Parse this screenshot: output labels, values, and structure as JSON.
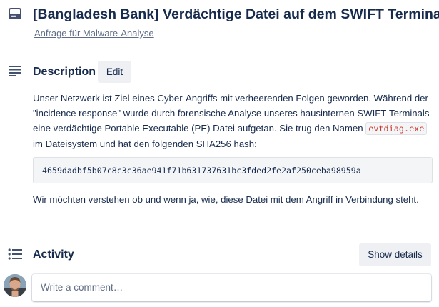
{
  "card": {
    "title": "[Bangladesh Bank] Verdächtige Datei auf dem SWIFT Terminal",
    "list_link": "Anfrage für Malware-Analyse",
    "icon": "card-icon"
  },
  "description": {
    "icon": "description-lines-icon",
    "heading": "Description",
    "edit_label": "Edit",
    "para1_part1": "Unser Netzwerk ist Ziel eines Cyber-Angriffs mit verheerenden Folgen geworden. Während der \"incidence response\" wurde durch forensische Analyse unseres hausinternen SWIFT-Terminals eine verdächtige Portable Executable (PE) Datei aufgetan. Sie trug den Namen",
    "file_name": "evtdiag.exe",
    "para1_part2": "im Dateisystem und hat den folgenden SHA256 hash:",
    "hash": "4659dadbf5b07c8c3c36ae941f71b631737631bc3fded2fe2af250ceba98959a",
    "para2": "Wir möchten verstehen ob und wenn ja, wie, diese Datei mit dem Angriff in Verbindung steht."
  },
  "activity": {
    "icon": "activity-list-icon",
    "heading": "Activity",
    "show_details_label": "Show details",
    "comment_placeholder": "Write a comment…"
  },
  "colors": {
    "text": "#172b4d",
    "muted": "#5e6c84",
    "button_bg": "#eef0f3",
    "code_bg": "#f4f5f7",
    "inline_code": "#c9372c"
  }
}
